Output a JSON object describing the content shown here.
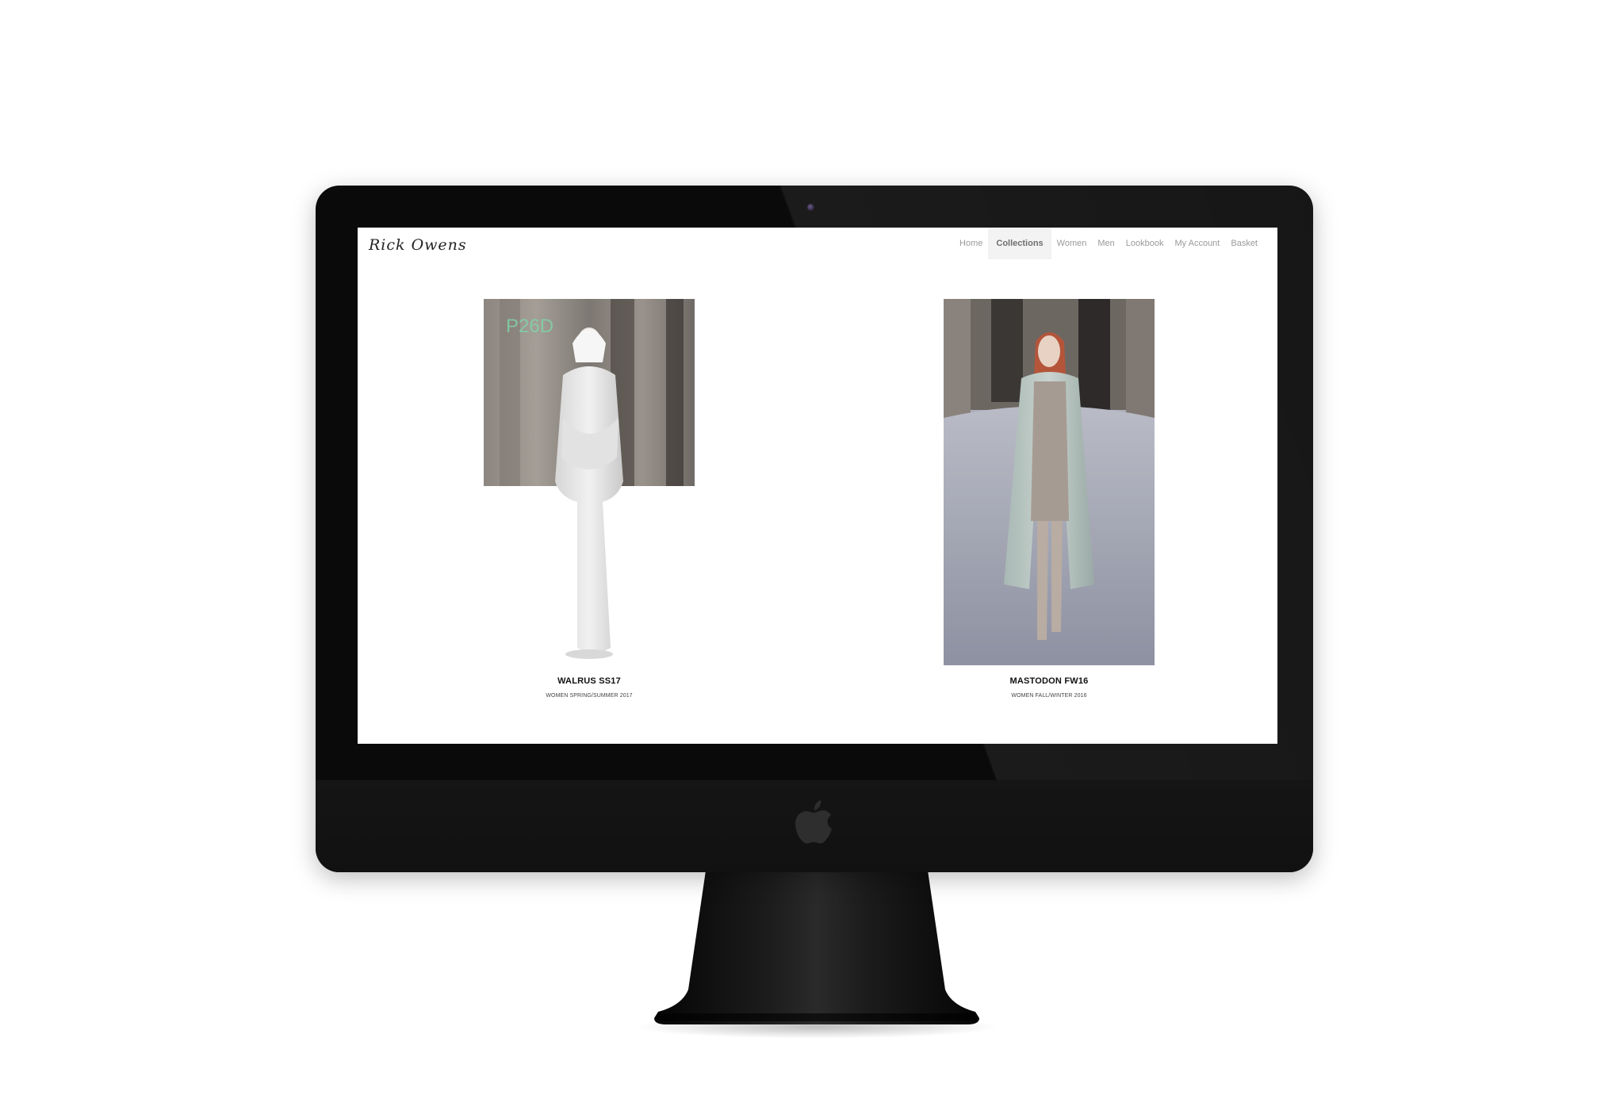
{
  "site": {
    "logo_text": "Rick Owens"
  },
  "nav": {
    "items": [
      {
        "label": "Home",
        "active": false
      },
      {
        "label": "Collections",
        "active": true
      },
      {
        "label": "Women",
        "active": false
      },
      {
        "label": "Men",
        "active": false
      },
      {
        "label": "Lookbook",
        "active": false
      },
      {
        "label": "My Account",
        "active": false
      },
      {
        "label": "Basket",
        "active": false
      }
    ]
  },
  "collections": [
    {
      "title": "WALRUS SS17",
      "subtitle": "WOMEN SPRING/SUMMER 2017",
      "image": "runway-model-white-draped-dress"
    },
    {
      "title": "MASTODON FW16",
      "subtitle": "WOMEN FALL/WINTER 2016",
      "image": "runway-model-grey-coat"
    }
  ],
  "colors": {
    "monitor_frame": "#0a0a0a",
    "screen_bg": "#ffffff",
    "nav_text": "#9a9a9a",
    "nav_active_bg": "#f3f3f3"
  },
  "device": {
    "brand_icon": "apple-logo-icon",
    "camera_icon": "camera-icon"
  }
}
